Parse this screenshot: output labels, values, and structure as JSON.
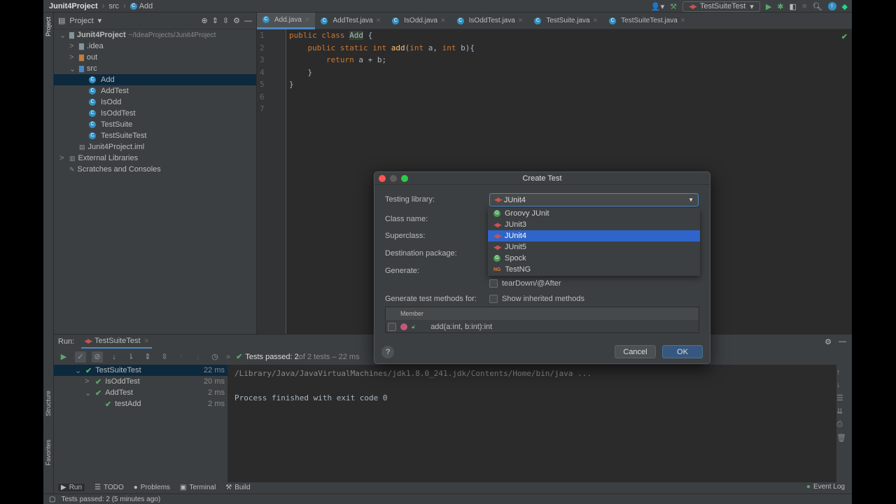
{
  "breadcrumb": [
    "Junit4Project",
    "src",
    "Add"
  ],
  "toolbar": {
    "run_config": "TestSuiteTest"
  },
  "left_strip": {
    "project": "Project",
    "structure": "Structure",
    "favorites": "Favorites"
  },
  "project": {
    "title": "Project",
    "tree": [
      {
        "label": "Junit4Project",
        "extra": "~/IdeaProjects/Junit4Project",
        "indent": 0,
        "arrow": "v",
        "icon": "folder",
        "bold": true
      },
      {
        "label": ".idea",
        "indent": 1,
        "arrow": ">",
        "icon": "folder"
      },
      {
        "label": "out",
        "indent": 1,
        "arrow": ">",
        "icon": "folder-orange"
      },
      {
        "label": "src",
        "indent": 1,
        "arrow": "v",
        "icon": "folder-blue"
      },
      {
        "label": "Add",
        "indent": 2,
        "icon": "class",
        "selected": true
      },
      {
        "label": "AddTest",
        "indent": 2,
        "icon": "class"
      },
      {
        "label": "IsOdd",
        "indent": 2,
        "icon": "class"
      },
      {
        "label": "IsOddTest",
        "indent": 2,
        "icon": "class"
      },
      {
        "label": "TestSuite",
        "indent": 2,
        "icon": "class"
      },
      {
        "label": "TestSuiteTest",
        "indent": 2,
        "icon": "class"
      },
      {
        "label": "Junit4Project.iml",
        "indent": 1,
        "icon": "file"
      },
      {
        "label": "External Libraries",
        "indent": 0,
        "arrow": ">",
        "icon": "library"
      },
      {
        "label": "Scratches and Consoles",
        "indent": 0,
        "icon": "scratch"
      }
    ]
  },
  "tabs": [
    "Add.java",
    "AddTest.java",
    "IsOdd.java",
    "IsOddTest.java",
    "TestSuite.java",
    "TestSuiteTest.java"
  ],
  "code": [
    [
      [
        "kw",
        "public class "
      ],
      [
        "cl",
        "Add"
      ],
      [
        "pl",
        " {"
      ]
    ],
    [
      [
        "pl",
        "    "
      ],
      [
        "kw",
        "public static int "
      ],
      [
        "fn",
        "add"
      ],
      [
        "pl",
        "("
      ],
      [
        "kw",
        "int "
      ],
      [
        "pl",
        "a, "
      ],
      [
        "kw",
        "int "
      ],
      [
        "pl",
        "b){"
      ]
    ],
    [
      [
        "pl",
        "        "
      ],
      [
        "kw",
        "return "
      ],
      [
        "pl",
        "a + b;"
      ]
    ],
    [
      [
        "pl",
        "    }"
      ]
    ],
    [
      [
        "pl",
        "}"
      ]
    ],
    [],
    []
  ],
  "run": {
    "label": "Run:",
    "tab": "TestSuiteTest",
    "summary_bold": "Tests passed: 2",
    "summary_rest": " of 2 tests – 22 ms",
    "tree": [
      {
        "label": "TestSuiteTest",
        "time": "22 ms",
        "indent": 0,
        "arrow": "v"
      },
      {
        "label": "IsOddTest",
        "time": "20 ms",
        "indent": 1,
        "arrow": ">"
      },
      {
        "label": "AddTest",
        "time": "2 ms",
        "indent": 1,
        "arrow": "v"
      },
      {
        "label": "testAdd",
        "time": "2 ms",
        "indent": 2
      }
    ],
    "console": [
      "/Library/Java/JavaVirtualMachines/jdk1.8.0_241.jdk/Contents/Home/bin/java ...",
      "",
      "Process finished with exit code 0"
    ]
  },
  "bottom_tabs": [
    "Run",
    "TODO",
    "Problems",
    "Terminal",
    "Build"
  ],
  "event_log": "Event Log",
  "status": "Tests passed: 2 (5 minutes ago)",
  "dialog": {
    "title": "Create Test",
    "testing_library_label": "Testing library:",
    "selected": "JUnit4",
    "class_name_label": "Class name:",
    "superclass_label": "Superclass:",
    "destination_label": "Destination package:",
    "generate_label": "Generate:",
    "options": [
      {
        "label": "Groovy JUnit",
        "icon": "groovy"
      },
      {
        "label": "JUnit3",
        "icon": "junit"
      },
      {
        "label": "JUnit4",
        "icon": "junit",
        "highlighted": true
      },
      {
        "label": "JUnit5",
        "icon": "junit"
      },
      {
        "label": "Spock",
        "icon": "groovy"
      },
      {
        "label": "TestNG",
        "icon": "testng"
      }
    ],
    "teardown": "tearDown/@After",
    "methods_label": "Generate test methods for:",
    "show_inherited": "Show inherited methods",
    "member_header": "Member",
    "member": "add(a:int, b:int):int",
    "cancel": "Cancel",
    "ok": "OK",
    "help": "?"
  }
}
